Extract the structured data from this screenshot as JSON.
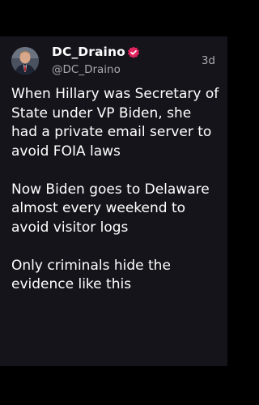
{
  "post": {
    "author": {
      "display_name": "DC_Draino",
      "handle": "@DC_Draino",
      "verified": true,
      "avatar_icon": "user-avatar"
    },
    "timestamp": "3d",
    "paragraphs": [
      "When Hillary was Secretary of State under VP Biden, she had a private email server to avoid FOIA laws",
      "Now Biden goes to Delaware almost every weekend to avoid visitor logs",
      "Only criminals hide the evidence like this"
    ]
  },
  "colors": {
    "background": "#000000",
    "card": "#15141b",
    "text_primary": "#ffffff",
    "text_secondary": "#a8a8b0",
    "verified_badge": "#e0245e"
  }
}
